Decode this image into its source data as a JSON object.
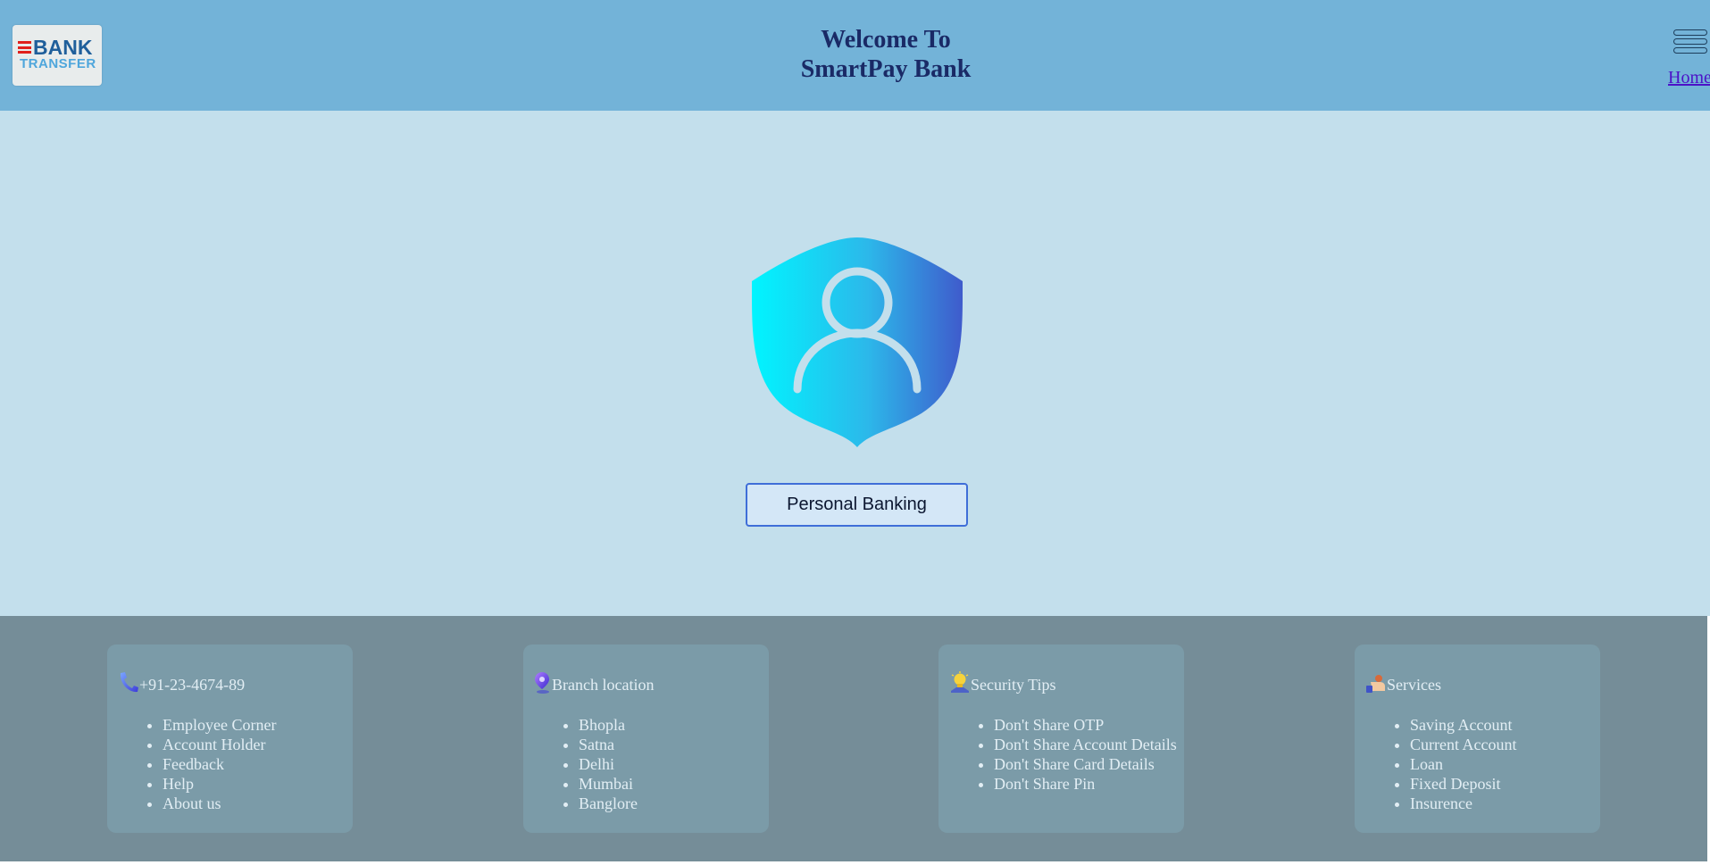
{
  "header": {
    "logo": {
      "line1": "BANK",
      "line2": "TRANSFER"
    },
    "title_line1": "Welcome To",
    "title_line2": "SmartPay Bank",
    "menu_icon": "hamburger-menu-icon",
    "home_link": "Home"
  },
  "main": {
    "hero_icon": "user-shield-icon",
    "personal_banking_button": "Personal Banking"
  },
  "footer": {
    "cards": [
      {
        "icon": "phone-icon",
        "heading": "+91-23-4674-89",
        "items": [
          "Employee Corner",
          "Account Holder",
          "Feedback",
          "Help",
          "About us"
        ]
      },
      {
        "icon": "location-pin-icon",
        "heading": "Branch location",
        "items": [
          "Bhopla",
          "Satna",
          "Delhi",
          "Mumbai",
          "Banglore"
        ]
      },
      {
        "icon": "lightbulb-icon",
        "heading": "Security Tips",
        "items": [
          "Don't Share OTP",
          "Don't Share Account Details",
          "Don't Share Card Details",
          "Don't Share Pin"
        ]
      },
      {
        "icon": "services-hand-icon",
        "heading": "Services",
        "items": [
          "Saving Account",
          "Current Account",
          "Loan",
          "Fixed Deposit",
          "Insurence"
        ]
      }
    ]
  },
  "colors": {
    "header_bg": "#73b3d8",
    "main_bg": "#c3dfec",
    "footer_bg": "#758d98",
    "card_bg": "#7b9ba8",
    "title_text": "#1a2a66",
    "button_border": "#3f6ed8"
  }
}
